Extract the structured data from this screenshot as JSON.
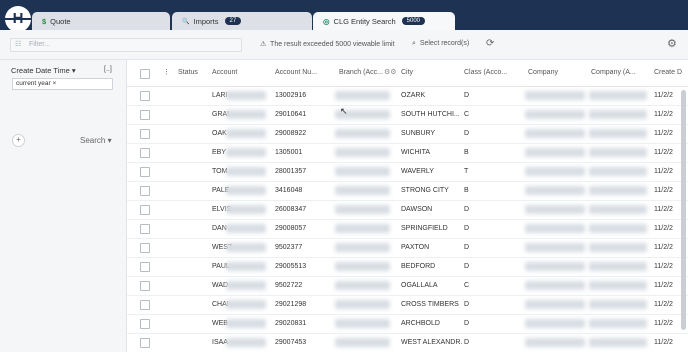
{
  "tabs": [
    {
      "icon": "$",
      "label": "Quote"
    },
    {
      "icon": "🔍",
      "label": "Imports",
      "badge": "27"
    },
    {
      "icon": "◎",
      "label": "CLG Entity Search",
      "badge": "5000"
    }
  ],
  "toolbar": {
    "filter_placeholder": "Filter...",
    "warning": "The result exceeded 5000 viewable limit",
    "select_records": "Select record(s)"
  },
  "sidebar": {
    "filter_label": "Create Date Time",
    "bracket": "[..]",
    "chip": "current year",
    "search_label": "Search"
  },
  "columns": [
    "Status",
    "Account",
    "Account Nu...",
    "Branch (Acc...",
    "City",
    "Class (Acco...",
    "Company",
    "Company (A...",
    "Create D"
  ],
  "rows": [
    {
      "account": "LARI",
      "number": "13002916",
      "city": "OZARK",
      "class": "D",
      "date": "11/2/2"
    },
    {
      "account": "GRAI",
      "number": "29010641",
      "city": "SOUTH HUTCHI...",
      "class": "C",
      "date": "11/2/2"
    },
    {
      "account": "OAK",
      "number": "29008922",
      "city": "SUNBURY",
      "class": "D",
      "date": "11/2/2"
    },
    {
      "account": "EBY",
      "number": "1305001",
      "city": "WICHITA",
      "class": "B",
      "date": "11/2/2"
    },
    {
      "account": "TOM",
      "number": "28001357",
      "city": "WAVERLY",
      "class": "T",
      "date": "11/2/2"
    },
    {
      "account": "PALE",
      "number": "3416048",
      "city": "STRONG CITY",
      "class": "B",
      "date": "11/2/2"
    },
    {
      "account": "ELVIS",
      "number": "26008347",
      "city": "DAWSON",
      "class": "D",
      "date": "11/2/2"
    },
    {
      "account": "DAN",
      "number": "29008057",
      "city": "SPRINGFIELD",
      "class": "D",
      "date": "11/2/2"
    },
    {
      "account": "WEST",
      "number": "9502377",
      "city": "PAXTON",
      "class": "D",
      "date": "11/2/2"
    },
    {
      "account": "PAUL",
      "number": "29005513",
      "city": "BEDFORD",
      "class": "D",
      "date": "11/2/2"
    },
    {
      "account": "WAD",
      "number": "9502722",
      "city": "OGALLALA",
      "class": "C",
      "date": "11/2/2"
    },
    {
      "account": "CHAI",
      "number": "29021298",
      "city": "CROSS TIMBERS",
      "class": "D",
      "date": "11/2/2"
    },
    {
      "account": "WEB",
      "number": "29020831",
      "city": "ARCHBOLD",
      "class": "D",
      "date": "11/2/2"
    },
    {
      "account": "ISAA",
      "number": "29007453",
      "city": "WEST ALEXANDR...",
      "class": "D",
      "date": "11/2/2"
    }
  ]
}
